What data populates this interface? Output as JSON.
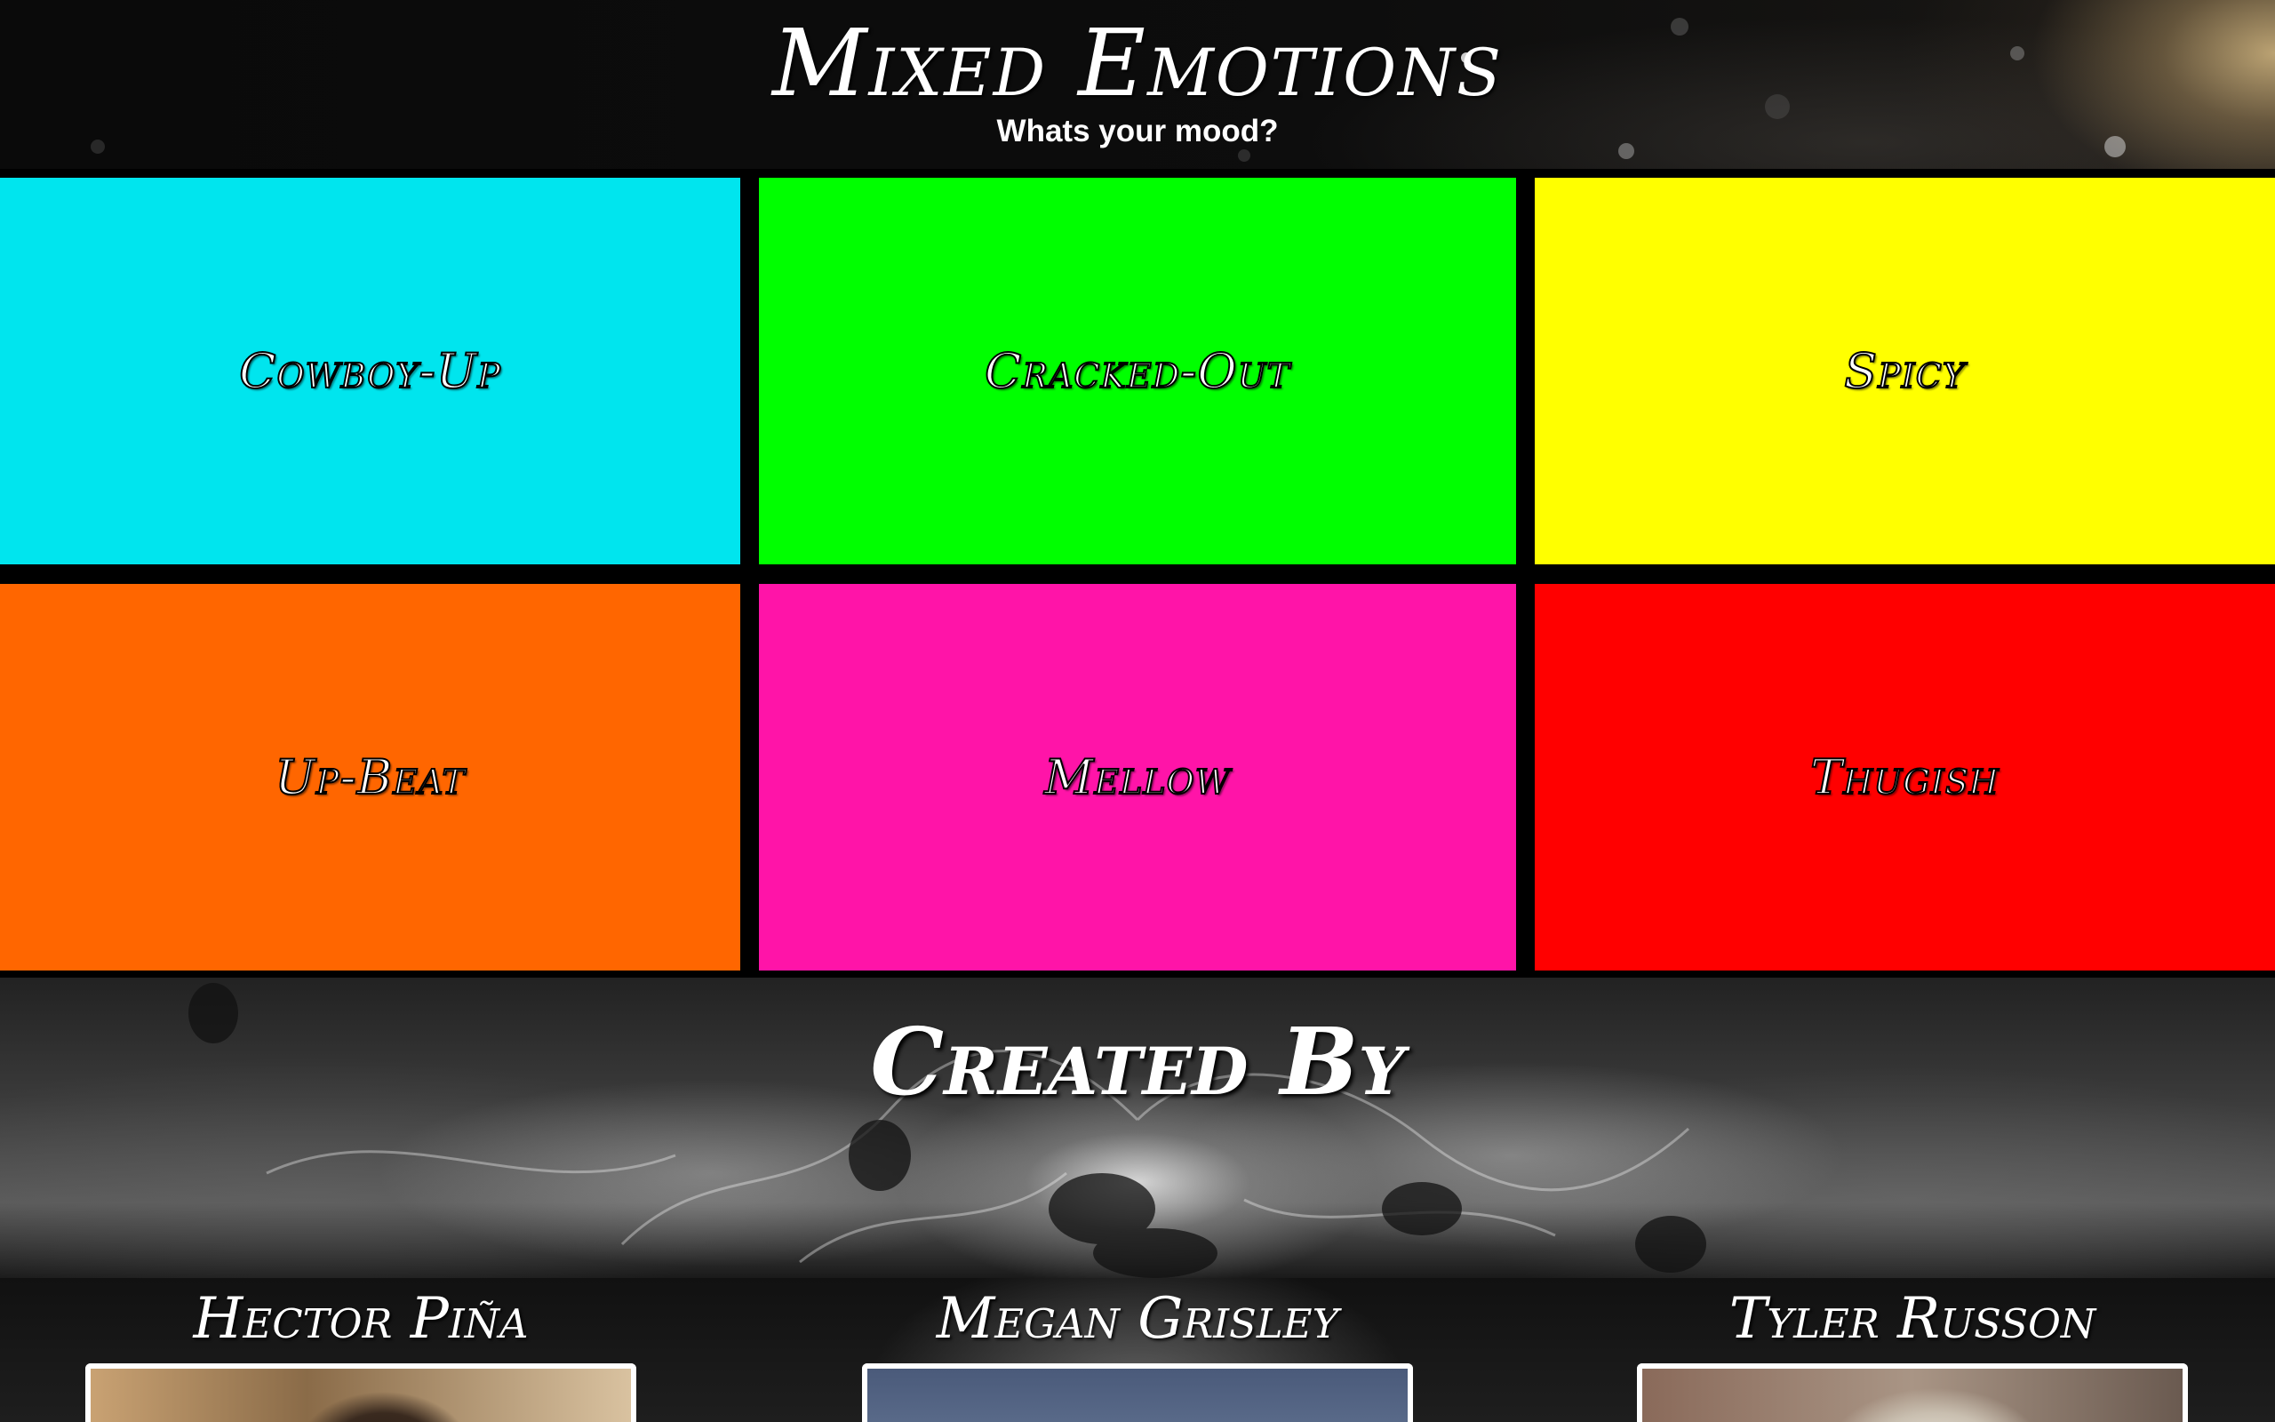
{
  "header": {
    "title": "Mixed Emotions",
    "subtitle": "Whats your mood?"
  },
  "moods": [
    {
      "label": "Cowboy-Up",
      "color": "#00E5EE"
    },
    {
      "label": "Cracked-Out",
      "color": "#00FF00"
    },
    {
      "label": "Spicy",
      "color": "#FFFF00"
    },
    {
      "label": "Up-Beat",
      "color": "#FF6600"
    },
    {
      "label": "Mellow",
      "color": "#FF14A8"
    },
    {
      "label": "Thugish",
      "color": "#FF0000"
    }
  ],
  "credits": {
    "title": "Created By",
    "creators": [
      {
        "name": "Hector Piña"
      },
      {
        "name": "Megan Grisley"
      },
      {
        "name": "Tyler Russon"
      }
    ]
  }
}
